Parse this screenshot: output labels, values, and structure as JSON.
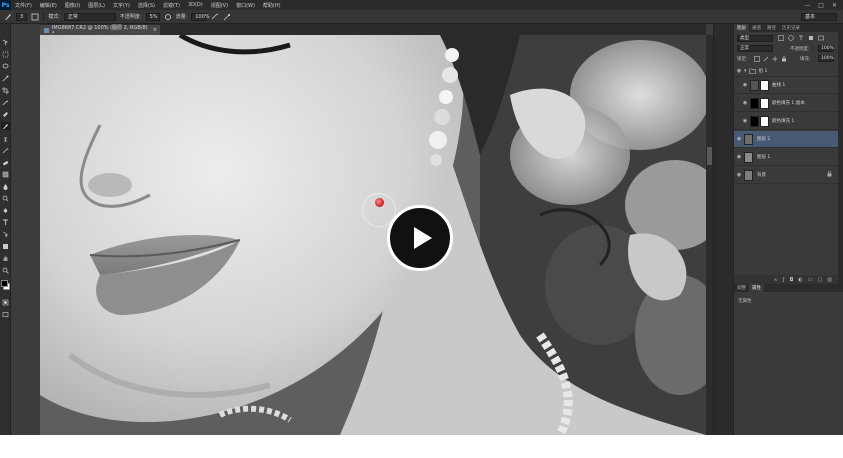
{
  "menubar": {
    "logo": "Ps",
    "items": [
      "文件(F)",
      "编辑(E)",
      "图像(I)",
      "图层(L)",
      "文字(Y)",
      "选择(S)",
      "滤镜(T)",
      "3D(D)",
      "视图(V)",
      "窗口(W)",
      "帮助(H)"
    ],
    "minimize": "—",
    "maximize": "□",
    "close": "✕"
  },
  "options": {
    "brush_size": "3",
    "mode_label": "模式:",
    "mode_value": "正常",
    "opacity_label": "不透明度:",
    "opacity_value": "5%",
    "flow_label": "流量:",
    "flow_value": "100%",
    "workspace": "基本"
  },
  "document": {
    "tab_title": "IMG8687.CR2 @ 100% (图层 2, RGB/8) *",
    "close": "×"
  },
  "video": {
    "play_label": "play"
  },
  "layers_panel": {
    "tabs": [
      "图层",
      "通道",
      "路径",
      "历史记录"
    ],
    "filter_value": "类型",
    "blend_mode": "正常",
    "opacity_label": "不透明度:",
    "opacity_value": "100%",
    "lock_label": "锁定:",
    "fill_label": "填充:",
    "fill_value": "100%",
    "group_name": "组 1",
    "layers": [
      {
        "name": "曲线 1"
      },
      {
        "name": "颜色填充 1 副本"
      },
      {
        "name": "颜色填充 1"
      },
      {
        "name": "图层 2"
      },
      {
        "name": "图层 1"
      },
      {
        "name": "背景"
      }
    ]
  },
  "properties_panel": {
    "tabs": [
      "调整",
      "属性"
    ],
    "body": "无属性"
  },
  "colors": {
    "selected_layer": "#485a73",
    "app_bg": "#3c3c3c"
  }
}
